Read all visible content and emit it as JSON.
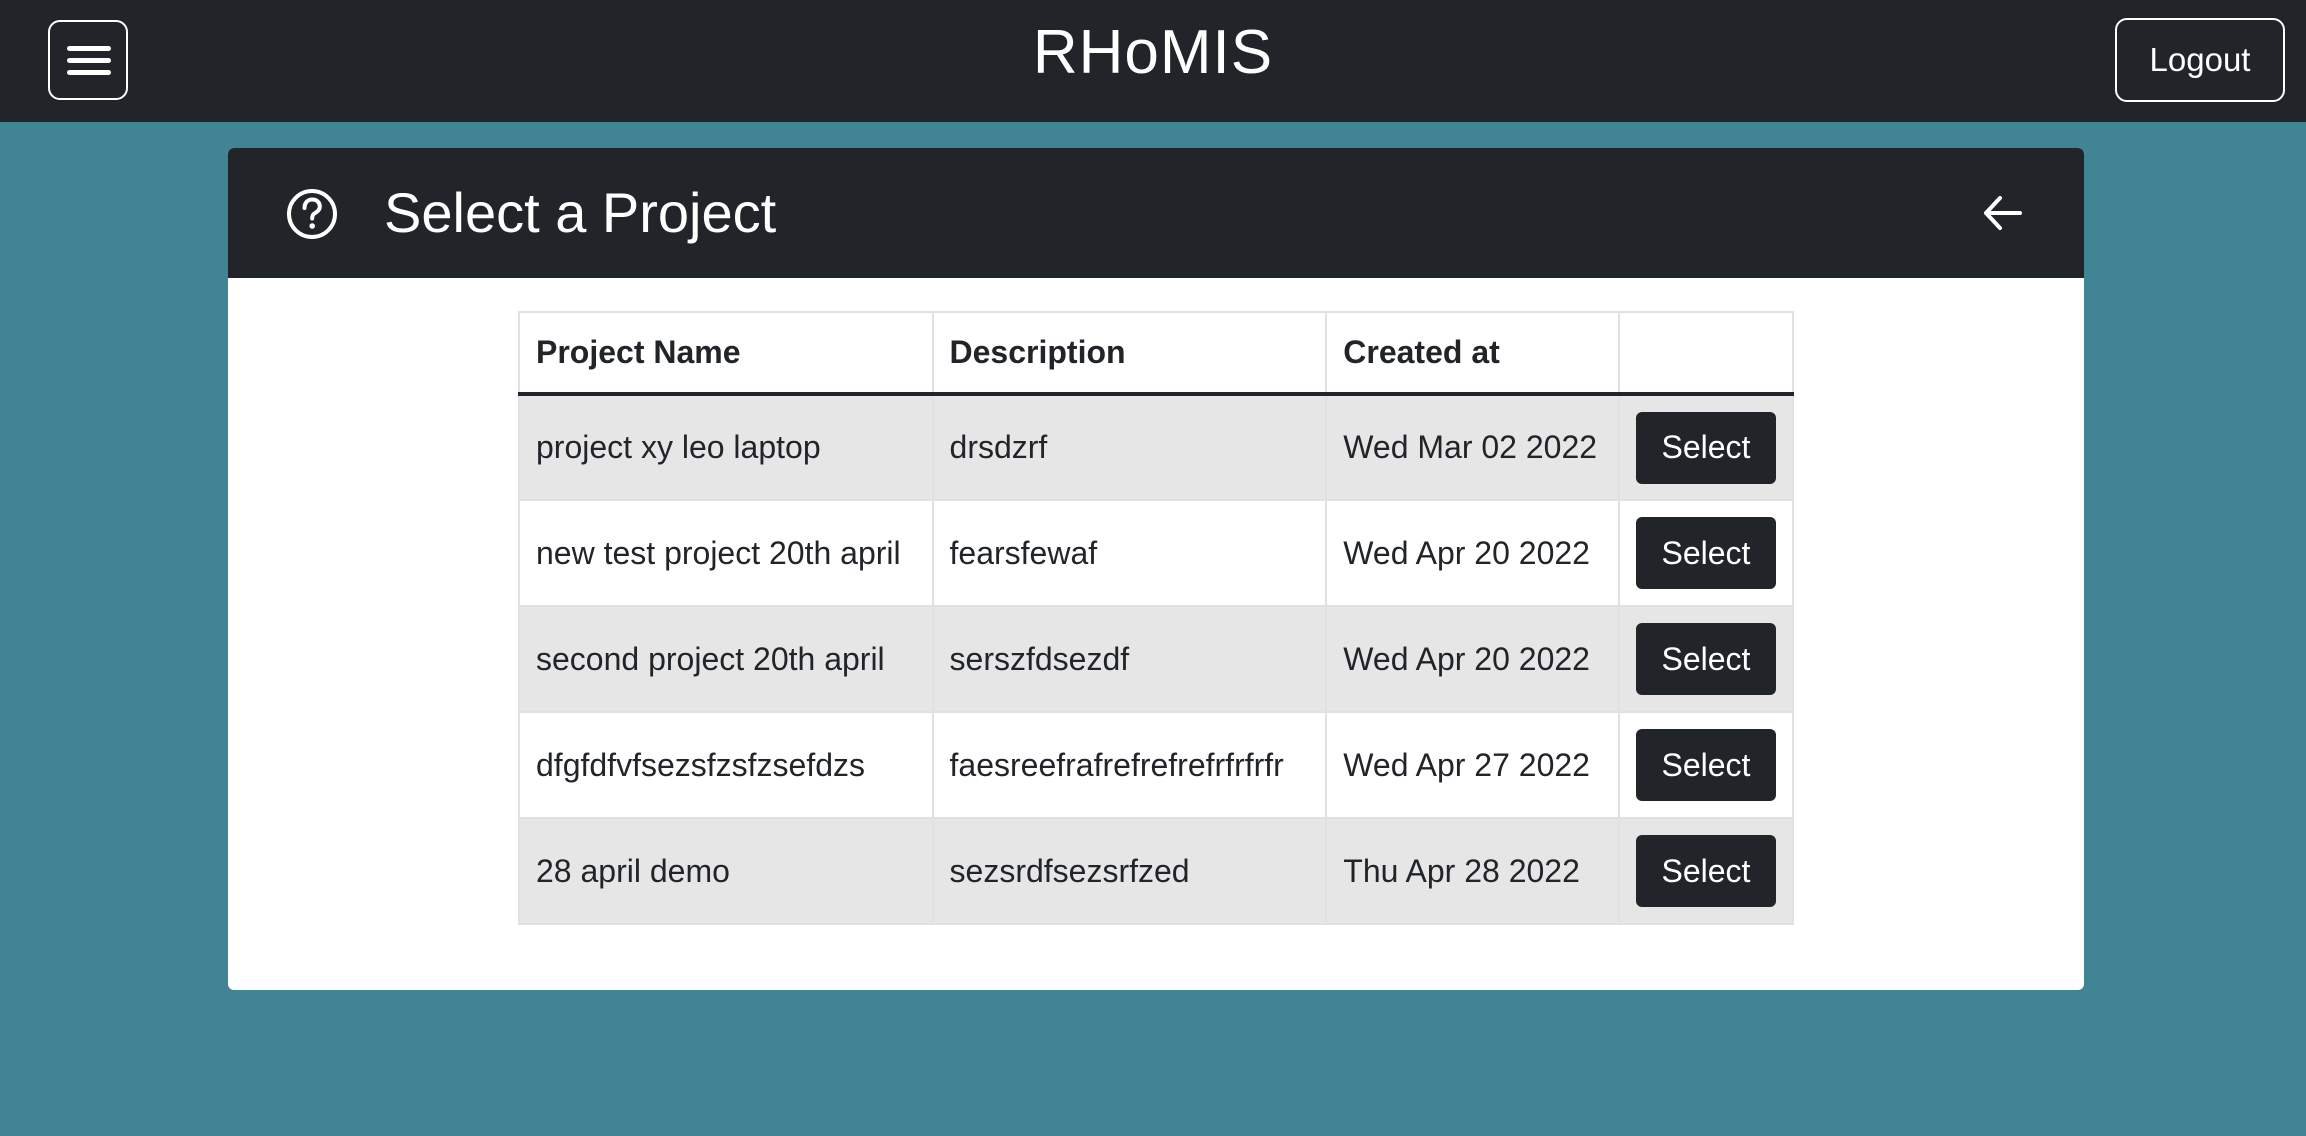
{
  "navbar": {
    "menu_icon": "hamburger-menu-icon",
    "brand": "RHoMIS",
    "logout_label": "Logout"
  },
  "card": {
    "title": "Select a Project",
    "help_icon": "question-circle-icon",
    "back_icon": "arrow-left-icon"
  },
  "table": {
    "headers": {
      "name": "Project Name",
      "description": "Description",
      "created": "Created at",
      "action": ""
    },
    "rows": [
      {
        "name": "project xy leo laptop",
        "description": "drsdzrf",
        "created": "Wed Mar 02 2022",
        "action": "Select"
      },
      {
        "name": "new test project 20th april",
        "description": "fearsfewaf",
        "created": "Wed Apr 20 2022",
        "action": "Select"
      },
      {
        "name": "second project 20th april",
        "description": "serszfdsezdf",
        "created": "Wed Apr 20 2022",
        "action": "Select"
      },
      {
        "name": "dfgfdfvfsezsfzsfzsefdzs",
        "description": "faesreefrafrefrefrefrfrfrfr",
        "created": "Wed Apr 27 2022",
        "action": "Select"
      },
      {
        "name": "28 april demo",
        "description": "sezsrdfsezsrfzed",
        "created": "Thu Apr 28 2022",
        "action": "Select"
      }
    ]
  },
  "colors": {
    "page_background": "#418494",
    "navbar": "#212529",
    "stripe": "#e6e6e6",
    "button": "#212529"
  }
}
